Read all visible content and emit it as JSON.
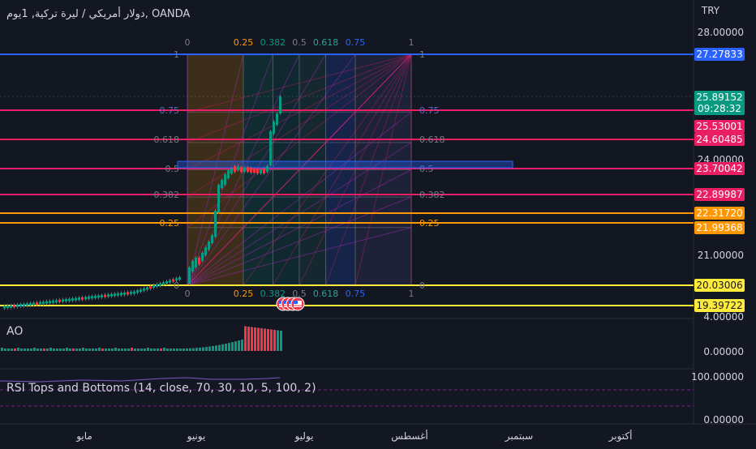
{
  "header": {
    "title": "دولار أمريكي / ليرة تركية, 1يوم, OANDA",
    "currency": "TRY"
  },
  "panes": {
    "ao_label": "AO",
    "rsi_label": "RSI Tops and Bottoms (14, close, 70, 30, 10, 5, 100, 2)"
  },
  "price_axis": {
    "ticks": [
      "28.00000",
      "24.00000",
      "21.00000",
      "4.00000",
      "0.00000",
      "100.00000",
      "0.00000"
    ]
  },
  "price_tags": [
    {
      "label": "27.27833",
      "color": "#2962ff"
    },
    {
      "label": "25.89152",
      "sub": "09:28:32",
      "color": "#089981"
    },
    {
      "label": "25.53001",
      "color": "#e91e63"
    },
    {
      "label": "24.60485",
      "color": "#e91e63"
    },
    {
      "label": "23.70042",
      "color": "#e91e63"
    },
    {
      "label": "22.89987",
      "color": "#e91e63"
    },
    {
      "label": "22.31720",
      "color": "#ff9800"
    },
    {
      "label": "21.99368",
      "color": "#ff9800"
    },
    {
      "label": "20.03006",
      "color": "#ffeb3b",
      "text_color": "#131722"
    },
    {
      "label": "19.39722",
      "color": "#ffeb3b",
      "text_color": "#131722"
    }
  ],
  "fib_levels": {
    "top_labels": [
      "0",
      "0.25",
      "0.382",
      "0.5",
      "0.618",
      "0.75",
      "1"
    ],
    "bottom_labels": [
      "0",
      "0.25",
      "0.382",
      "0.5",
      "0.618",
      "0.75",
      "1"
    ],
    "left_labels": [
      "1",
      "0.75",
      "0.618",
      "0.5",
      "0.382",
      "0.25",
      "0"
    ],
    "right_labels": [
      "1",
      "0.75",
      "0.618",
      "0.5",
      "0.382",
      "0.25",
      "0"
    ]
  },
  "time_axis": [
    "مايو",
    "يونيو",
    "يوليو",
    "أغسطس",
    "سبتمبر",
    "أكتوبر"
  ],
  "colors": {
    "background": "#131722",
    "up": "#089981",
    "down": "#f23645",
    "blue_line": "#2962ff",
    "pink_line": "#e91e63",
    "orange_line": "#ff9800",
    "yellow_line": "#ffeb3b"
  },
  "icons": {
    "event_flags": "us-flag-icon"
  }
}
